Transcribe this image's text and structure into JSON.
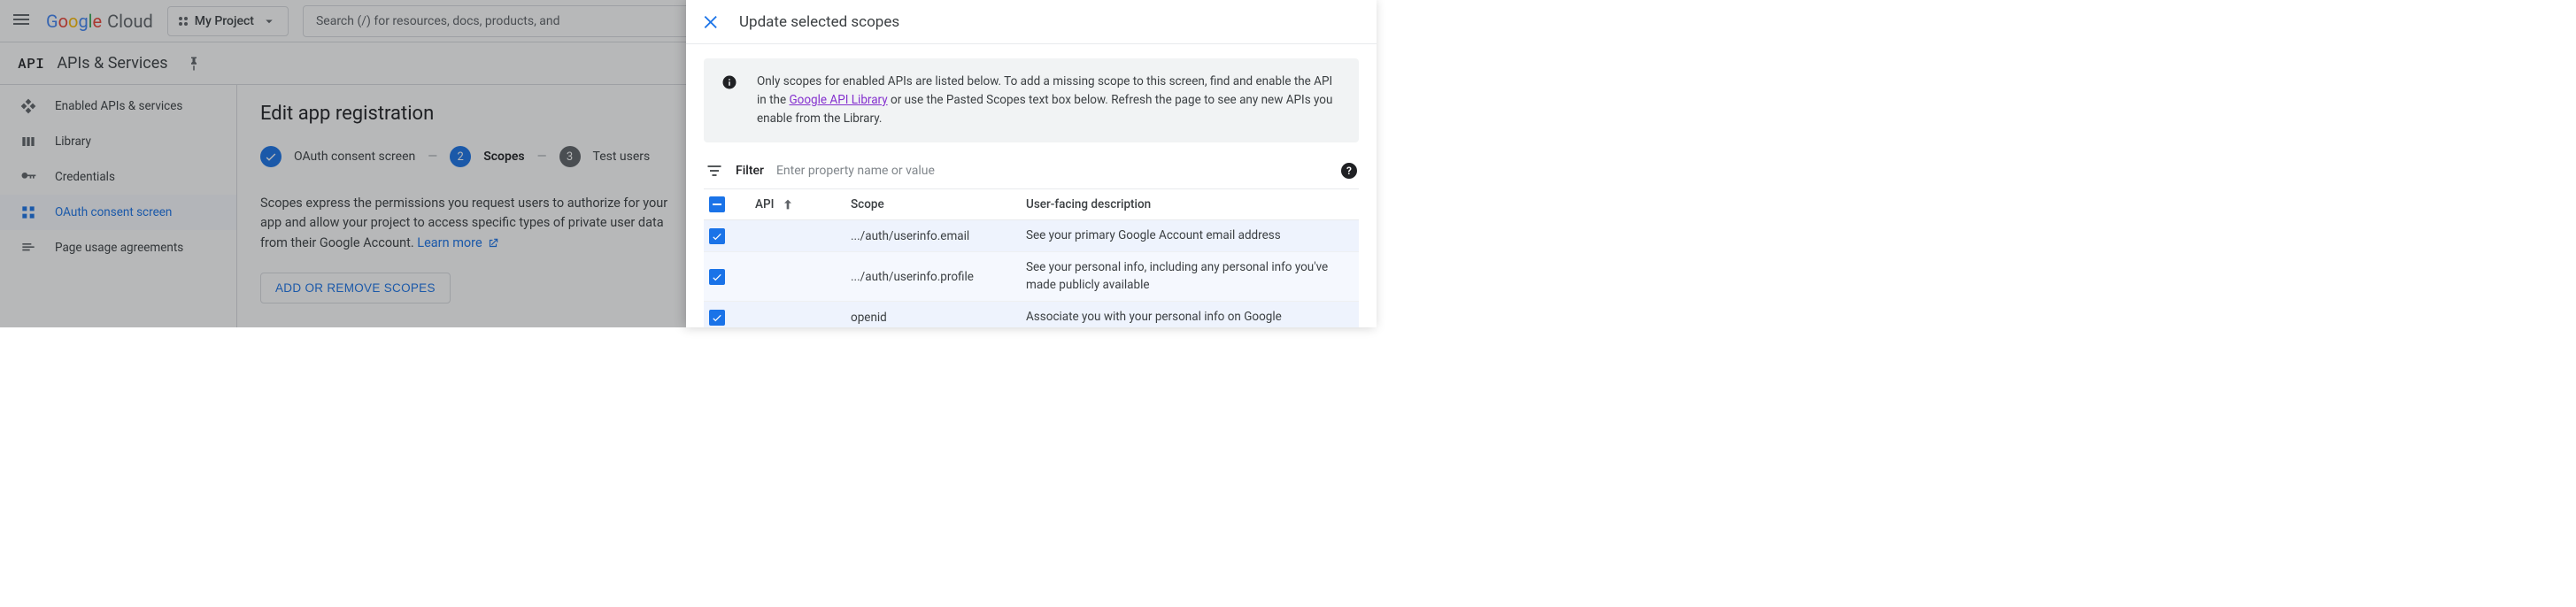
{
  "topbar": {
    "logo_google": [
      "G",
      "o",
      "o",
      "g",
      "l",
      "e"
    ],
    "logo_cloud": "Cloud",
    "project_label": "My Project",
    "search_placeholder": "Search (/) for resources, docs, products, and"
  },
  "page": {
    "api_word": "API",
    "api_title": "APIs & Services"
  },
  "sidebar": {
    "items": [
      {
        "label": "Enabled APIs & services"
      },
      {
        "label": "Library"
      },
      {
        "label": "Credentials"
      },
      {
        "label": "OAuth consent screen"
      },
      {
        "label": "Page usage agreements"
      }
    ]
  },
  "content": {
    "title": "Edit app registration",
    "steps": {
      "s1": "OAuth consent screen",
      "s2_num": "2",
      "s2": "Scopes",
      "s3_num": "3",
      "s3": "Test users"
    },
    "desc_pre": "Scopes express the permissions you request users to authorize for your app and allow your project to access specific types of private user data from their Google Account. ",
    "learn_more": "Learn more",
    "button": "ADD OR REMOVE SCOPES"
  },
  "panel": {
    "title": "Update selected scopes",
    "info_pre": "Only scopes for enabled APIs are listed below. To add a missing scope to this screen, find and enable the API in the ",
    "info_link": "Google API Library",
    "info_post": " or use the Pasted Scopes text box below. Refresh the page to see any new APIs you enable from the Library.",
    "filter_label": "Filter",
    "filter_placeholder": "Enter property name or value",
    "columns": {
      "api": "API",
      "scope": "Scope",
      "desc": "User-facing description"
    },
    "rows": [
      {
        "api": "",
        "scope": ".../auth/userinfo.email",
        "desc": "See your primary Google Account email address"
      },
      {
        "api": "",
        "scope": ".../auth/userinfo.profile",
        "desc": "See your personal info, including any personal info you've made publicly available"
      },
      {
        "api": "",
        "scope": "openid",
        "desc": "Associate you with your personal info on Google"
      }
    ]
  }
}
